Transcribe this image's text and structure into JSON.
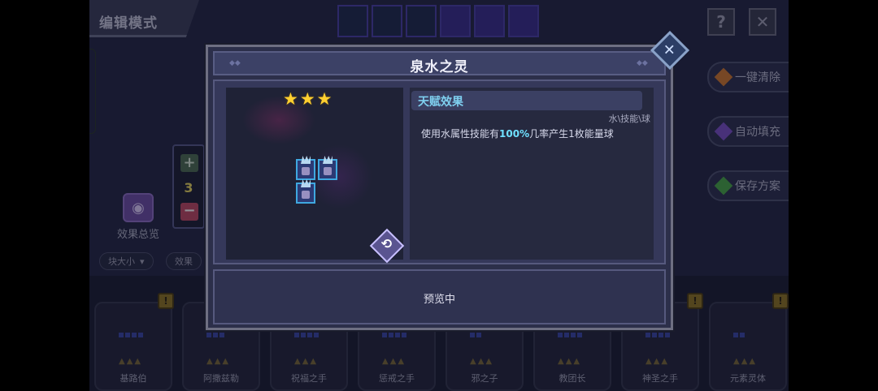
{
  "header": {
    "mode_title": "编辑模式",
    "help_icon": "question-icon",
    "close_icon": "close-icon"
  },
  "side_buttons": [
    {
      "label": "一键清除",
      "gem_color": "#d07830"
    },
    {
      "label": "自动填充",
      "gem_color": "#7a50c8"
    },
    {
      "label": "保存方案",
      "gem_color": "#48a848"
    }
  ],
  "counter": {
    "plus": "+",
    "value": "3",
    "minus": "−"
  },
  "overview": {
    "label": "效果总览"
  },
  "filters": [
    {
      "label": "块大小"
    },
    {
      "label": "效果"
    }
  ],
  "cards": [
    {
      "name": "基路伯"
    },
    {
      "name": "阿撒兹勒"
    },
    {
      "name": "祝福之手"
    },
    {
      "name": "惩戒之手"
    },
    {
      "name": "邪之子"
    },
    {
      "name": "教团长"
    },
    {
      "name": "神圣之手"
    },
    {
      "name": "元素灵体"
    }
  ],
  "modal": {
    "title": "泉水之灵",
    "stars": "★★★",
    "talent_title": "天赋效果",
    "tags": "水\\技能\\球",
    "desc_prefix": "使用水属性技能有",
    "desc_highlight": "100%",
    "desc_suffix": "几率产生1枚能量球",
    "status": "预览中"
  },
  "colors": {
    "accent_cyan": "#6fe0ff",
    "star_gold": "#ffd030",
    "minus_red": "#c04a64",
    "plus_green": "#4d6d55"
  }
}
